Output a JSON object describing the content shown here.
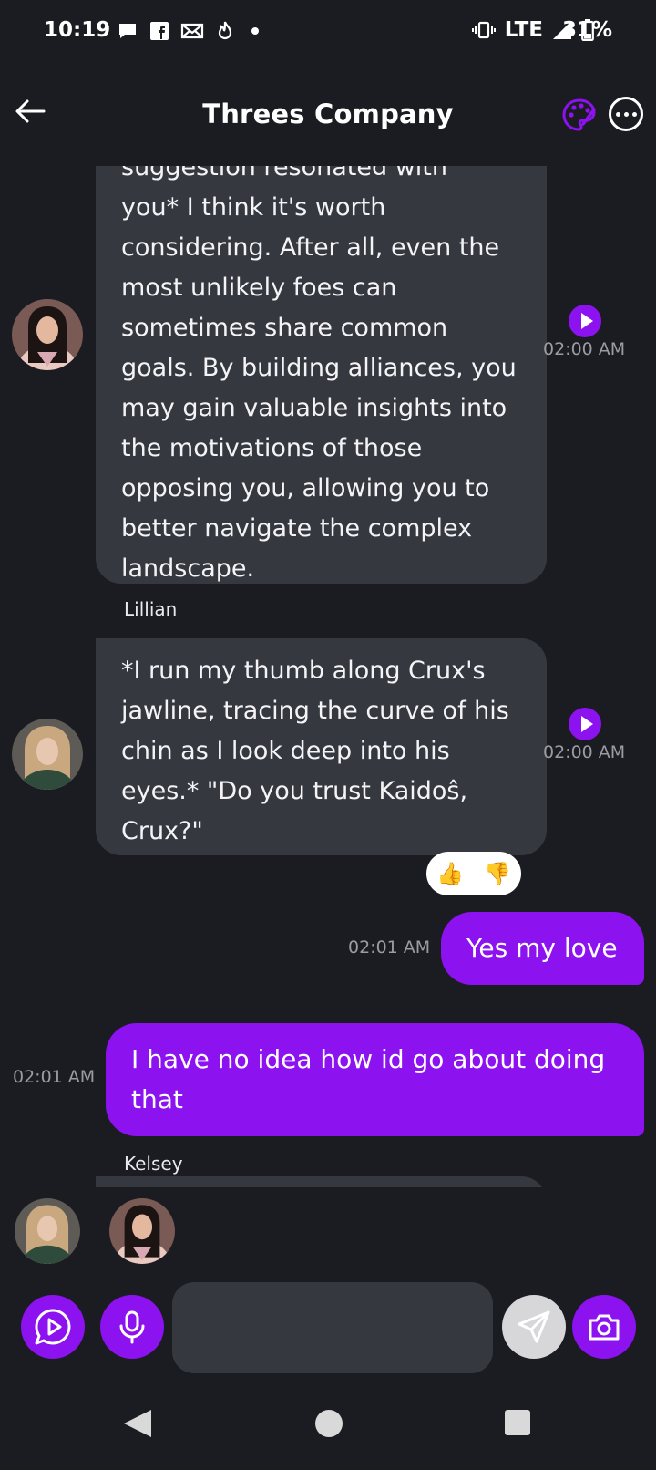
{
  "status_bar": {
    "time": "10:19",
    "network": "LTE",
    "battery": "31%",
    "icons": [
      "chat-bubble-icon",
      "facebook-icon",
      "mail-icon",
      "fire-icon",
      "dot-icon",
      "vibrate-icon",
      "signal-icon",
      "battery-icon"
    ]
  },
  "header": {
    "title": "Threes Company",
    "back_icon": "arrow-left-icon",
    "palette_icon": "palette-icon",
    "more_icon": "more-icon"
  },
  "messages": {
    "m1": {
      "text_partial_top": "suggestion resonated with",
      "text": "you* I think it's worth considering. After all, even the most unlikely foes can sometimes share common goals. By building alliances, you may gain valuable insights into the motivations of those opposing you, allowing you to better navigate the complex landscape.",
      "time": "02:00 AM"
    },
    "m2": {
      "sender": "Lillian",
      "text": "*I run my thumb along Crux's jawline, tracing the curve of his chin as I look deep into his eyes.* \"Do you trust Kaidoŝ, Crux?\"",
      "time": "02:00 AM",
      "reactions": [
        "👍",
        "👎"
      ]
    },
    "m3": {
      "text": "Yes my love",
      "time": "02:01 AM"
    },
    "m4": {
      "text": "I have no idea how id go about doing that",
      "time": "02:01 AM"
    },
    "m5": {
      "sender": "Kelsey"
    }
  },
  "input": {
    "placeholder": ""
  },
  "colors": {
    "accent": "#8c12f0",
    "background": "#1b1c21",
    "bubble": "#363840"
  }
}
